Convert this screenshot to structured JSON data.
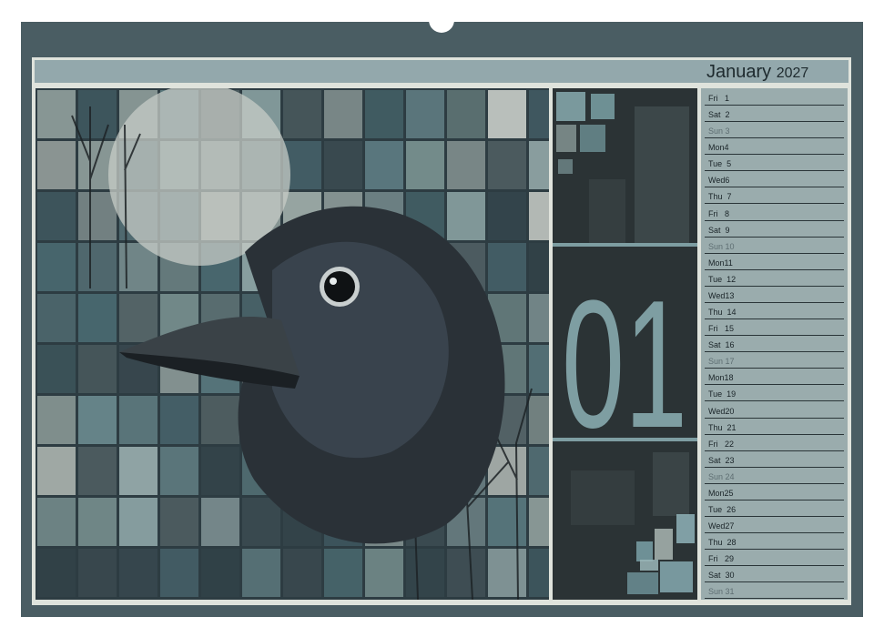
{
  "calendar": {
    "month": "January",
    "year": "2027",
    "big_number": "01",
    "days": [
      {
        "label": "Fri   1",
        "sunday": false
      },
      {
        "label": "Sat  2",
        "sunday": false
      },
      {
        "label": "Sun 3",
        "sunday": true
      },
      {
        "label": "Mon4",
        "sunday": false
      },
      {
        "label": "Tue  5",
        "sunday": false
      },
      {
        "label": "Wed6",
        "sunday": false
      },
      {
        "label": "Thu  7",
        "sunday": false
      },
      {
        "label": "Fri   8",
        "sunday": false
      },
      {
        "label": "Sat  9",
        "sunday": false
      },
      {
        "label": "Sun 10",
        "sunday": true
      },
      {
        "label": "Mon11",
        "sunday": false
      },
      {
        "label": "Tue  12",
        "sunday": false
      },
      {
        "label": "Wed13",
        "sunday": false
      },
      {
        "label": "Thu  14",
        "sunday": false
      },
      {
        "label": "Fri   15",
        "sunday": false
      },
      {
        "label": "Sat  16",
        "sunday": false
      },
      {
        "label": "Sun 17",
        "sunday": true
      },
      {
        "label": "Mon18",
        "sunday": false
      },
      {
        "label": "Tue  19",
        "sunday": false
      },
      {
        "label": "Wed20",
        "sunday": false
      },
      {
        "label": "Thu  21",
        "sunday": false
      },
      {
        "label": "Fri   22",
        "sunday": false
      },
      {
        "label": "Sat  23",
        "sunday": false
      },
      {
        "label": "Sun 24",
        "sunday": true
      },
      {
        "label": "Mon25",
        "sunday": false
      },
      {
        "label": "Tue  26",
        "sunday": false
      },
      {
        "label": "Wed27",
        "sunday": false
      },
      {
        "label": "Thu  28",
        "sunday": false
      },
      {
        "label": "Fri   29",
        "sunday": false
      },
      {
        "label": "Sat  30",
        "sunday": false
      },
      {
        "label": "Sun 31",
        "sunday": true
      }
    ]
  },
  "colors": {
    "frame": "#4a5d63",
    "header_bar": "#93a8ac",
    "day_panel": "#9aacad",
    "big_number": "#7e9ea2"
  }
}
